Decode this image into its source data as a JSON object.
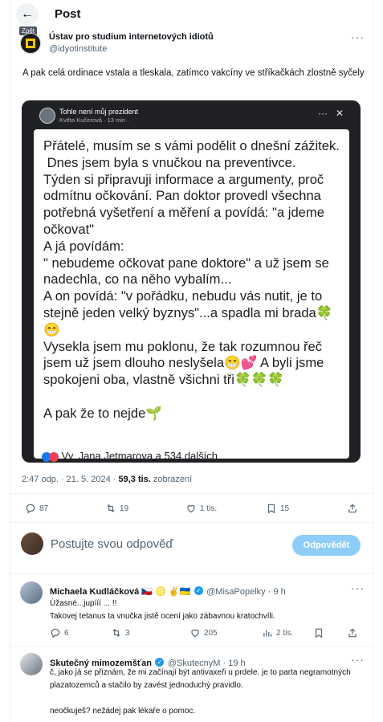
{
  "header": {
    "title": "Post",
    "back_tooltip": "Zpět"
  },
  "author": {
    "name": "Ústav pro studium internetových idiotů",
    "handle": "@idyotinstitute"
  },
  "tweet": {
    "text": "A pak celá ordinace vstala a tleskala, zatímco vakcíny ve stříkačkách zlostně syčely"
  },
  "media": {
    "group_name": "Tohle není můj prezident",
    "poster": "Květa Kučerová · 13 min · ",
    "post_text": "Přátelé, musím se s vámi podělit o dnešní zážitek.\n Dnes jsem byla s vnučkou na preventivce.\nTýden si připravuji informace a argumenty, proč odmítnu očkování. Pan doktor provedl všechna potřebná vyšetření a měření a povídá: \"a jdeme očkovat\"\nA já povídám:\n\" nebudeme očkovat pane doktore\" a už jsem se nadechla, co na něho vybalím...\nA on povídá: \"v pořádku, nebudu vás nutit, je to stejně jeden velký byznys\"...a spadla mi brada🍀😁\nVysekla jsem mu poklonu, že tak rozumnou řeč jsem už jsem dlouho neslyšela😁💕 A byli jsme spokojeni oba, vlastně všichni tři🍀🍀🍀\n\nA pak že to nejde🌱",
    "reactions": "Vy, Jana Jetmarova a 534 dalších"
  },
  "stats": {
    "time": "2:47 odp. · 21. 5. 2024 · ",
    "views": "59,3 tis.",
    "views_label": " zobrazení"
  },
  "actions": {
    "replies": "87",
    "reposts": "19",
    "likes": "1 tis.",
    "bookmarks": "15"
  },
  "reply_box": {
    "placeholder": "Postujte svou odpověď",
    "button": "Odpovědět"
  },
  "comments": [
    {
      "name": "Michaela Kudláčková 🇨🇿 ♌ ✌️🇺🇦",
      "handle": "@MisaPopelky · 9 h",
      "text": "Úžasné...jupííí ... !!\nTakovej tetanus ta vnučka jistě ocení jako zábavnou kratochvíli.",
      "replies": "6",
      "reposts": "3",
      "likes": "205",
      "views": "2 tis."
    },
    {
      "name": "Skutečný mimozemšťan",
      "handle": "@SkutecnyM · 19 h",
      "text": "č, jako já se přiznám, že mi začínají být antivaxeři u prdele. je to parta negramotných plazatozemců a stačilo by zavést jednoduchý pravidlo.\n\nneočkuješ? nežádej pak lékaře o pomoc."
    }
  ],
  "colors": {
    "accent": "#1d9bf0",
    "reply_button": "#8ecdf8",
    "text": "#0f1419",
    "muted": "#536471"
  }
}
